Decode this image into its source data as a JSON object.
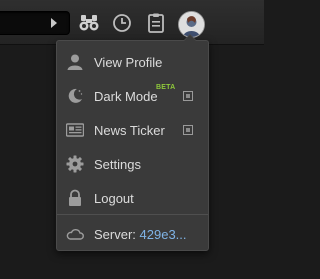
{
  "topbar": {
    "icons": [
      "binoculars-icon",
      "clock-icon",
      "clipboard-icon",
      "user-avatar"
    ]
  },
  "menu": {
    "items": [
      {
        "label": "View Profile",
        "icon": "user-icon"
      },
      {
        "label": "Dark Mode",
        "icon": "moon-icon",
        "badge": "BETA",
        "toggle": true
      },
      {
        "label": "News Ticker",
        "icon": "news-icon",
        "toggle": true
      },
      {
        "label": "Settings",
        "icon": "gear-icon"
      },
      {
        "label": "Logout",
        "icon": "lock-icon"
      }
    ],
    "server": {
      "label": "Server:",
      "value": "429e3...",
      "icon": "cloud-icon"
    }
  },
  "colors": {
    "menu_bg": "#3a3a3a",
    "text": "#dcdcdc",
    "beta": "#8fc93a",
    "server_value": "#7fb3e6"
  }
}
